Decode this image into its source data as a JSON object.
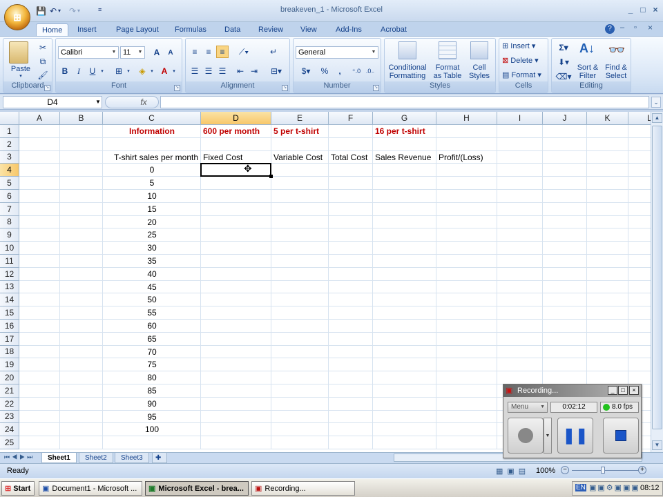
{
  "window": {
    "title": "breakeven_1 - Microsoft Excel",
    "min": "_",
    "max": "□",
    "close": "×"
  },
  "tabs": [
    "Home",
    "Insert",
    "Page Layout",
    "Formulas",
    "Data",
    "Review",
    "View",
    "Add-Ins",
    "Acrobat"
  ],
  "ribbon": {
    "clipboard": {
      "label": "Clipboard",
      "paste": "Paste"
    },
    "font": {
      "label": "Font",
      "name": "Calibri",
      "size": "11",
      "grow": "A",
      "shrink": "A",
      "bold": "B",
      "italic": "I",
      "underline": "U"
    },
    "alignment": {
      "label": "Alignment"
    },
    "number": {
      "label": "Number",
      "format": "General",
      "percent": "%",
      "comma": ","
    },
    "styles": {
      "label": "Styles",
      "conditional": "Conditional",
      "conditional2": "Formatting",
      "format_table": "Format",
      "format_table2": "as Table",
      "cell_styles": "Cell",
      "cell_styles2": "Styles"
    },
    "cells": {
      "label": "Cells",
      "insert": "Insert",
      "delete": "Delete",
      "format": "Format"
    },
    "editing": {
      "label": "Editing",
      "sigma": "Σ",
      "sort": "Sort &",
      "sort2": "Filter",
      "find": "Find &",
      "find2": "Select"
    }
  },
  "formula_bar": {
    "name_box": "D4",
    "fx": "fx",
    "value": ""
  },
  "columns": [
    "A",
    "B",
    "C",
    "D",
    "E",
    "F",
    "G",
    "H",
    "I",
    "J",
    "K",
    "L"
  ],
  "rows": [
    "1",
    "2",
    "3",
    "4",
    "5",
    "6",
    "7",
    "8",
    "9",
    "10",
    "11",
    "12",
    "13",
    "14",
    "15",
    "16",
    "17",
    "18",
    "19",
    "20",
    "21",
    "22",
    "23",
    "24",
    "25"
  ],
  "cells": {
    "C1": "Information",
    "D1": "600 per month",
    "E1": "5 per t-shirt",
    "G1": "16 per t-shirt",
    "C3": "T-shirt sales per month",
    "D3": "Fixed Cost",
    "E3": "Variable Cost",
    "F3": "Total Cost",
    "G3": "Sales Revenue",
    "H3": "Profit/(Loss)"
  },
  "sales_values": [
    "0",
    "5",
    "10",
    "15",
    "20",
    "25",
    "30",
    "35",
    "40",
    "45",
    "50",
    "55",
    "60",
    "65",
    "70",
    "75",
    "80",
    "85",
    "90",
    "95",
    "100"
  ],
  "selected_cell": "D4",
  "sheets": [
    "Sheet1",
    "Sheet2",
    "Sheet3"
  ],
  "active_sheet": "Sheet1",
  "status": {
    "ready": "Ready",
    "zoom": "100%"
  },
  "taskbar": {
    "start": "Start",
    "items": [
      "Document1 - Microsoft ...",
      "Microsoft Excel - brea...",
      "Recording..."
    ],
    "active_index": 1,
    "lang": "EN",
    "clock": "08:12"
  },
  "recorder": {
    "title": "Recording...",
    "menu": "Menu",
    "time": "0:02:12",
    "fps": "8.0 fps"
  },
  "colors": {
    "accent_red": "#c00000",
    "selection": "#f8c76a",
    "ribbon_blue": "#15428b",
    "recording_green": "#21c21d"
  }
}
